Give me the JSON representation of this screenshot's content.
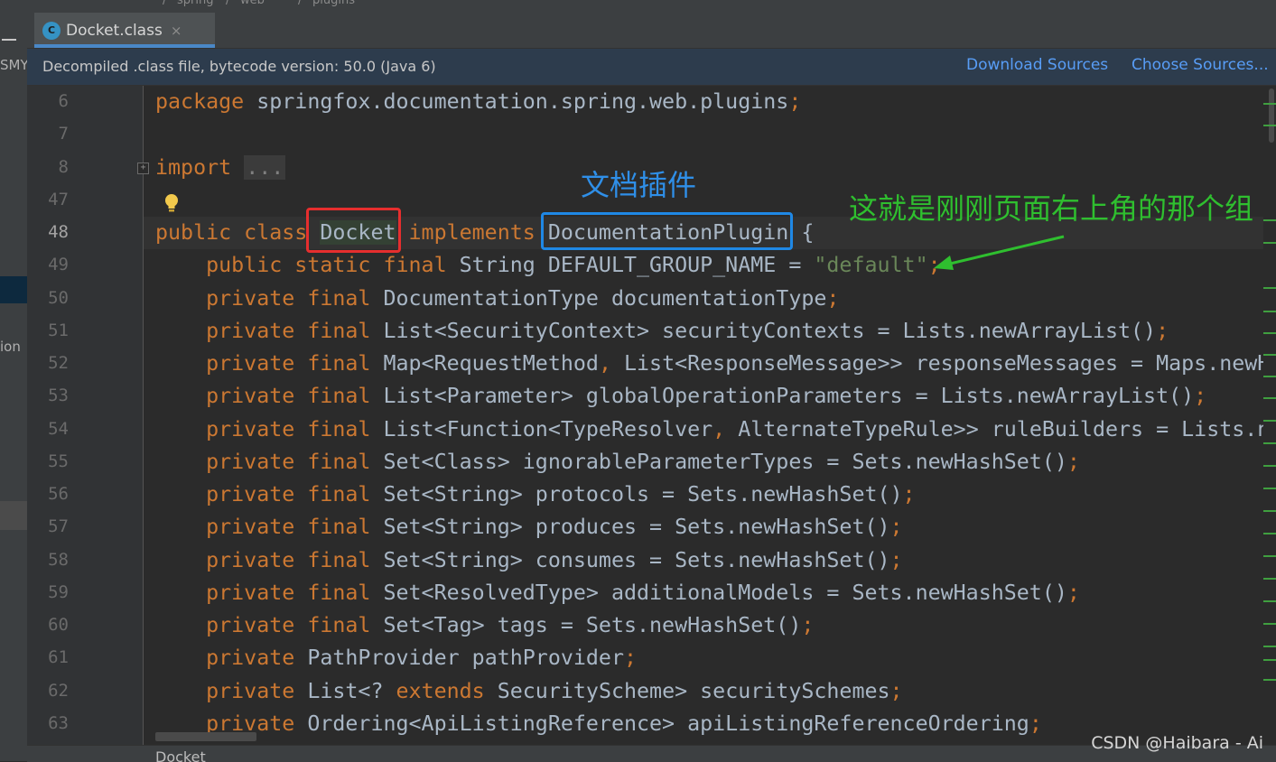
{
  "top_breadcrumb": [
    "/",
    "spring",
    "/",
    "web",
    "/",
    "plugins"
  ],
  "left_panel": {
    "fragments": [
      "SMY",
      "ion"
    ]
  },
  "tab": {
    "label": "Docket.class",
    "icon": "class-file-icon",
    "icon_letter": "C",
    "close": "×"
  },
  "banner": {
    "info": "Decompiled .class file, bytecode version: 50.0 (Java 6)",
    "download_sources": "Download Sources",
    "choose_sources": "Choose Sources..."
  },
  "editor": {
    "current_line": "48",
    "lines": [
      {
        "num": "6",
        "parts": [
          [
            "kw",
            "package "
          ],
          [
            "plain",
            "springfox.documentation.spring.web.plugins"
          ],
          [
            "kw",
            ";"
          ]
        ]
      },
      {
        "num": "7",
        "parts": []
      },
      {
        "num": "8",
        "parts": [
          [
            "kw",
            "import "
          ],
          [
            "fold",
            "..."
          ]
        ]
      },
      {
        "num": "47",
        "parts": []
      },
      {
        "num": "48",
        "parts": [
          [
            "kw",
            "public class "
          ],
          [
            "usage",
            "Docket"
          ],
          [
            "plain",
            " "
          ],
          [
            "kw",
            "implements "
          ],
          [
            "plain",
            "DocumentationPlugin {"
          ]
        ]
      },
      {
        "num": "49",
        "parts": [
          [
            "plain",
            "    "
          ],
          [
            "kw",
            "public static final "
          ],
          [
            "plain",
            "String DEFAULT_GROUP_NAME = "
          ],
          [
            "str",
            "\"default\""
          ],
          [
            "kw",
            ";"
          ]
        ]
      },
      {
        "num": "50",
        "parts": [
          [
            "plain",
            "    "
          ],
          [
            "kw",
            "private final "
          ],
          [
            "plain",
            "DocumentationType documentationType"
          ],
          [
            "kw",
            ";"
          ]
        ]
      },
      {
        "num": "51",
        "parts": [
          [
            "plain",
            "    "
          ],
          [
            "kw",
            "private final "
          ],
          [
            "plain",
            "List<SecurityContext> securityContexts = Lists.newArrayList()"
          ],
          [
            "kw",
            ";"
          ]
        ]
      },
      {
        "num": "52",
        "parts": [
          [
            "plain",
            "    "
          ],
          [
            "kw",
            "private final "
          ],
          [
            "plain",
            "Map<RequestMethod"
          ],
          [
            "kw",
            ", "
          ],
          [
            "plain",
            "List<ResponseMessage>> responseMessages = Maps.newHa"
          ]
        ]
      },
      {
        "num": "53",
        "parts": [
          [
            "plain",
            "    "
          ],
          [
            "kw",
            "private final "
          ],
          [
            "plain",
            "List<Parameter> globalOperationParameters = Lists.newArrayList()"
          ],
          [
            "kw",
            ";"
          ]
        ]
      },
      {
        "num": "54",
        "parts": [
          [
            "plain",
            "    "
          ],
          [
            "kw",
            "private final "
          ],
          [
            "plain",
            "List<Function<TypeResolver"
          ],
          [
            "kw",
            ", "
          ],
          [
            "plain",
            "AlternateTypeRule>> ruleBuilders = Lists.ne"
          ]
        ]
      },
      {
        "num": "55",
        "parts": [
          [
            "plain",
            "    "
          ],
          [
            "kw",
            "private final "
          ],
          [
            "plain",
            "Set<Class> ignorableParameterTypes = Sets.newHashSet()"
          ],
          [
            "kw",
            ";"
          ]
        ]
      },
      {
        "num": "56",
        "parts": [
          [
            "plain",
            "    "
          ],
          [
            "kw",
            "private final "
          ],
          [
            "plain",
            "Set<String> protocols = Sets.newHashSet()"
          ],
          [
            "kw",
            ";"
          ]
        ]
      },
      {
        "num": "57",
        "parts": [
          [
            "plain",
            "    "
          ],
          [
            "kw",
            "private final "
          ],
          [
            "plain",
            "Set<String> produces = Sets.newHashSet()"
          ],
          [
            "kw",
            ";"
          ]
        ]
      },
      {
        "num": "58",
        "parts": [
          [
            "plain",
            "    "
          ],
          [
            "kw",
            "private final "
          ],
          [
            "plain",
            "Set<String> consumes = Sets.newHashSet()"
          ],
          [
            "kw",
            ";"
          ]
        ]
      },
      {
        "num": "59",
        "parts": [
          [
            "plain",
            "    "
          ],
          [
            "kw",
            "private final "
          ],
          [
            "plain",
            "Set<ResolvedType> additionalModels = Sets.newHashSet()"
          ],
          [
            "kw",
            ";"
          ]
        ]
      },
      {
        "num": "60",
        "parts": [
          [
            "plain",
            "    "
          ],
          [
            "kw",
            "private final "
          ],
          [
            "plain",
            "Set<Tag> tags = Sets.newHashSet()"
          ],
          [
            "kw",
            ";"
          ]
        ]
      },
      {
        "num": "61",
        "parts": [
          [
            "plain",
            "    "
          ],
          [
            "kw",
            "private "
          ],
          [
            "plain",
            "PathProvider pathProvider"
          ],
          [
            "kw",
            ";"
          ]
        ]
      },
      {
        "num": "62",
        "parts": [
          [
            "plain",
            "    "
          ],
          [
            "kw",
            "private "
          ],
          [
            "plain",
            "List<? "
          ],
          [
            "kw",
            "extends "
          ],
          [
            "plain",
            "SecurityScheme> securitySchemes"
          ],
          [
            "kw",
            ";"
          ]
        ]
      },
      {
        "num": "63",
        "parts": [
          [
            "plain",
            "    "
          ],
          [
            "kw",
            "private "
          ],
          [
            "plain",
            "Ordering<ApiListingReference> apiListingReferenceOrdering"
          ],
          [
            "kw",
            ";"
          ]
        ]
      }
    ]
  },
  "annotations": {
    "blue_note": "文档插件",
    "green_note": "这就是刚刚页面右上角的那个组"
  },
  "colors": {
    "keyword": "#cc7832",
    "string": "#6a8759",
    "text": "#a9b7c6",
    "red_box": "#e62e2e",
    "blue_box": "#1f88e5",
    "green_note": "#2fbf2f"
  },
  "status_bar": {
    "breadcrumb": "Docket"
  },
  "watermark": "CSDN @Haibara - Ai"
}
